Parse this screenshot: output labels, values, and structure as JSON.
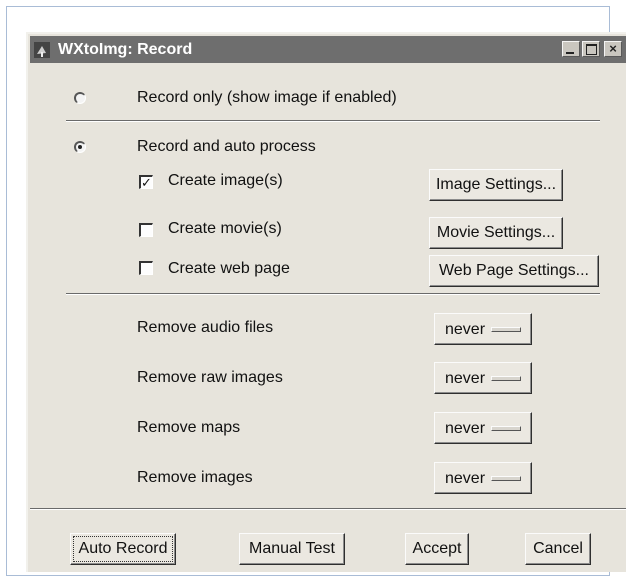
{
  "window": {
    "title": "WXtoImg: Record",
    "controls": {
      "minimize": "minimize",
      "maximize": "maximize",
      "close": "×"
    }
  },
  "mode": {
    "record_only_label": "Record only (show image if enabled)",
    "record_auto_label": "Record and auto process",
    "selected": "record_auto"
  },
  "options": {
    "create_images": {
      "label": "Create image(s)",
      "checked": true,
      "check_glyph": "✓",
      "settings_label": "Image Settings..."
    },
    "create_movies": {
      "label": "Create movie(s)",
      "checked": false,
      "settings_label": "Movie Settings..."
    },
    "create_web": {
      "label": "Create web page",
      "checked": false,
      "settings_label": "Web Page Settings..."
    }
  },
  "remove": {
    "audio": {
      "label": "Remove audio files",
      "value": "never"
    },
    "raw": {
      "label": "Remove raw images",
      "value": "never"
    },
    "maps": {
      "label": "Remove maps",
      "value": "never"
    },
    "images": {
      "label": "Remove images",
      "value": "never"
    }
  },
  "footer": {
    "auto_record": "Auto Record",
    "manual_test": "Manual Test",
    "accept": "Accept",
    "cancel": "Cancel"
  },
  "colors": {
    "titlebar": "#6e6e6e",
    "dialog_bg": "#e7e4dc"
  },
  "icons": {
    "app": "satellite-dish-icon"
  }
}
